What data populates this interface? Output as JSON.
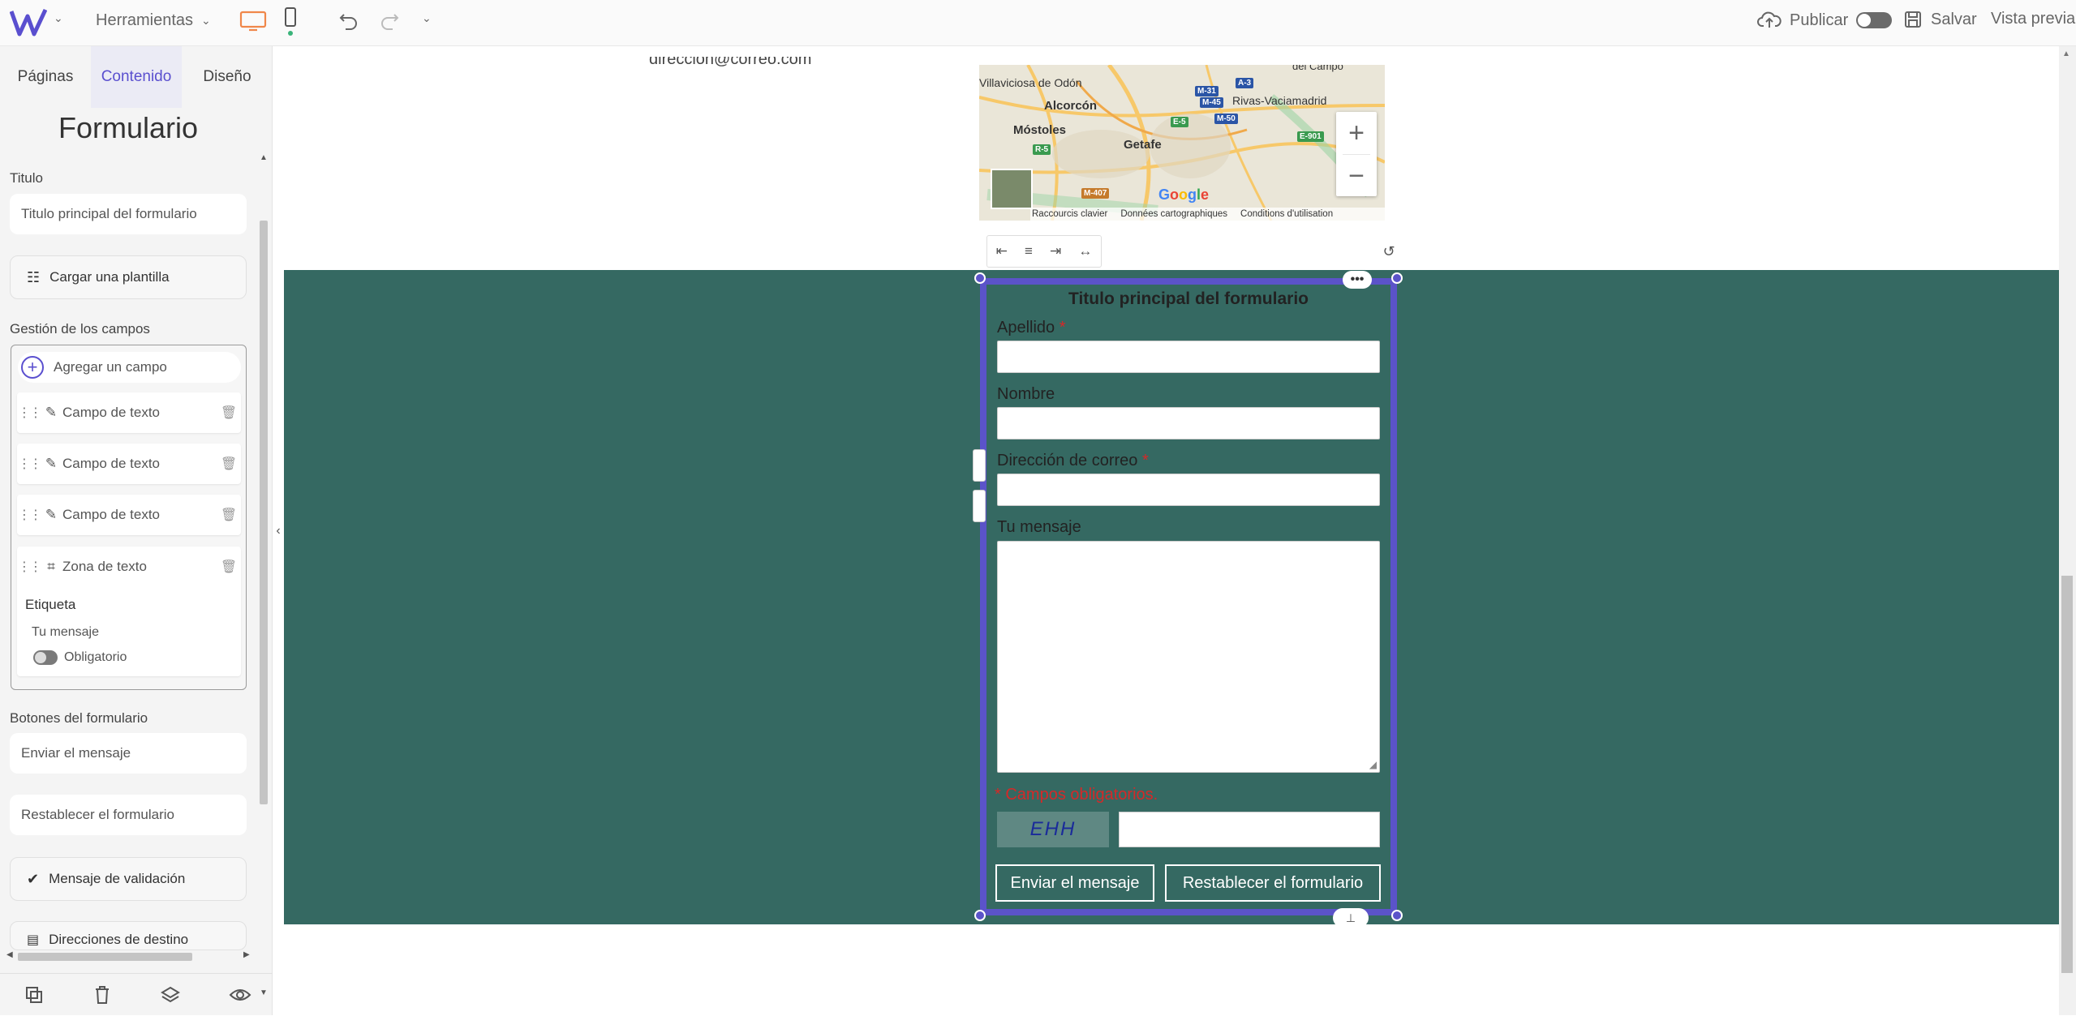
{
  "topbar": {
    "tools_label": "Herramientas",
    "publish_label": "Publicar",
    "save_label": "Salvar",
    "preview_label": "Vista previa"
  },
  "sidebar": {
    "tabs": [
      {
        "label": "Páginas"
      },
      {
        "label": "Contenido"
      },
      {
        "label": "Diseño"
      }
    ],
    "panel_title": "Formulario",
    "title_label": "Titulo",
    "title_value": "Titulo principal del formulario",
    "load_template_label": "Cargar una plantilla",
    "fields_management_label": "Gestión de los campos",
    "add_field_label": "Agregar un campo",
    "fields": [
      {
        "label": "Campo de texto",
        "icon": "pencil-icon"
      },
      {
        "label": "Campo de texto",
        "icon": "pencil-icon"
      },
      {
        "label": "Campo de texto",
        "icon": "pencil-icon"
      },
      {
        "label": "Zona de texto",
        "icon": "textarea-icon"
      }
    ],
    "expanded_field": {
      "tag_label": "Etiqueta",
      "tag_value": "Tu mensaje",
      "required_label": "Obligatorio"
    },
    "form_buttons_label": "Botones del formulario",
    "submit_value": "Enviar el mensaje",
    "reset_value": "Restablecer el formulario",
    "validation_message_label": "Mensaje de validación",
    "destinations_label": "Direcciones de destino"
  },
  "canvas": {
    "email_text": "direccion@correo.com",
    "map": {
      "places": [
        "Villaviciosa de Odón",
        "Alcorcón",
        "Móstoles",
        "Getafe",
        "Rivas-Vaciamadrid",
        "del Campo"
      ],
      "roads": [
        "M-31",
        "M-45",
        "A-3",
        "M-50",
        "E-5",
        "R-5",
        "E-901",
        "M-407"
      ],
      "attribution": [
        "Raccourcis clavier",
        "Données cartographiques",
        "Conditions d'utilisation"
      ],
      "logo_text": "Google"
    },
    "form": {
      "title": "Titulo principal del formulario",
      "fields": [
        {
          "label": "Apellido",
          "required": true
        },
        {
          "label": "Nombre",
          "required": false
        },
        {
          "label": "Dirección de correo",
          "required": true
        },
        {
          "label": "Tu mensaje",
          "required": false
        }
      ],
      "required_note": "* Campos obligatorios.",
      "captcha_text": "EHH",
      "submit_label": "Enviar el mensaje",
      "reset_label": "Restablecer el formulario"
    }
  },
  "colors": {
    "accent": "#5a4fcf",
    "section_bg": "#356962",
    "frame": "#5b53c9",
    "required": "#d62828"
  }
}
